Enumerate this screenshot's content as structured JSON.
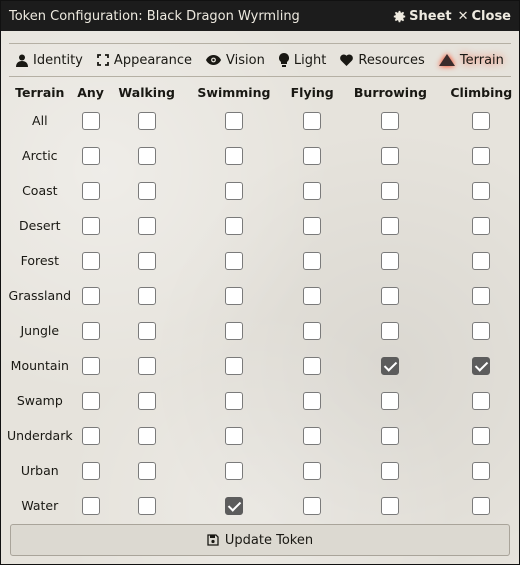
{
  "window": {
    "title": "Token Configuration: Black Dragon Wyrmling",
    "sheet_label": "Sheet",
    "close_label": "Close"
  },
  "tabs": [
    {
      "label": "Identity",
      "icon": "user-icon"
    },
    {
      "label": "Appearance",
      "icon": "expand-icon"
    },
    {
      "label": "Vision",
      "icon": "eye-icon"
    },
    {
      "label": "Light",
      "icon": "lightbulb-icon"
    },
    {
      "label": "Resources",
      "icon": "heart-icon"
    },
    {
      "label": "Terrain",
      "icon": "mountain-icon",
      "active": true
    }
  ],
  "grid": {
    "columns": [
      "Terrain",
      "Any",
      "Walking",
      "Swimming",
      "Flying",
      "Burrowing",
      "Climbing"
    ],
    "rows": [
      {
        "label": "All",
        "checks": [
          false,
          false,
          false,
          false,
          false,
          false
        ]
      },
      {
        "label": "Arctic",
        "checks": [
          false,
          false,
          false,
          false,
          false,
          false
        ]
      },
      {
        "label": "Coast",
        "checks": [
          false,
          false,
          false,
          false,
          false,
          false
        ]
      },
      {
        "label": "Desert",
        "checks": [
          false,
          false,
          false,
          false,
          false,
          false
        ]
      },
      {
        "label": "Forest",
        "checks": [
          false,
          false,
          false,
          false,
          false,
          false
        ]
      },
      {
        "label": "Grassland",
        "checks": [
          false,
          false,
          false,
          false,
          false,
          false
        ]
      },
      {
        "label": "Jungle",
        "checks": [
          false,
          false,
          false,
          false,
          false,
          false
        ]
      },
      {
        "label": "Mountain",
        "checks": [
          false,
          false,
          false,
          false,
          true,
          true
        ]
      },
      {
        "label": "Swamp",
        "checks": [
          false,
          false,
          false,
          false,
          false,
          false
        ]
      },
      {
        "label": "Underdark",
        "checks": [
          false,
          false,
          false,
          false,
          false,
          false
        ]
      },
      {
        "label": "Urban",
        "checks": [
          false,
          false,
          false,
          false,
          false,
          false
        ]
      },
      {
        "label": "Water",
        "checks": [
          false,
          false,
          true,
          false,
          false,
          false
        ]
      }
    ]
  },
  "footer": {
    "update_label": "Update Token"
  },
  "colors": {
    "titlebar": "#1c1c1c",
    "active_glow": "#ff2a00",
    "checked_fill": "#5c5c5c"
  }
}
